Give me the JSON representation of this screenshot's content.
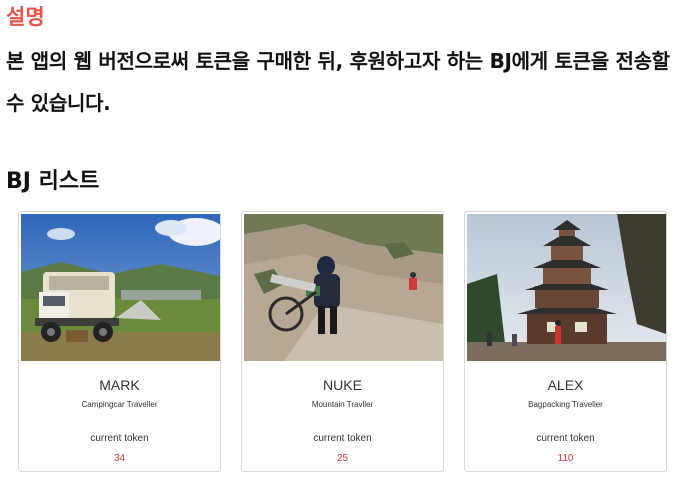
{
  "header": {
    "section_title": "설명",
    "description": "본 앱의 웹 버전으로써 토큰을 구매한 뒤, 후원하고자 하는 BJ에게 토큰을 전송할 수 있습니다.",
    "list_title": "BJ 리스트"
  },
  "colors": {
    "accent": "#e9534f",
    "token_value": "#d9363e"
  },
  "bj_list": [
    {
      "name": "MARK",
      "subtitle": "Campingcar Traveller",
      "token_label": "current token",
      "token_value": "34",
      "photo": "camping-truck-photo"
    },
    {
      "name": "NUKE",
      "subtitle": "Mountain Travller",
      "token_label": "current token",
      "token_value": "25",
      "photo": "mountain-hiker-photo"
    },
    {
      "name": "ALEX",
      "subtitle": "Bagpacking Traveller",
      "token_label": "current token",
      "token_value": "110",
      "photo": "japanese-castle-photo"
    }
  ]
}
